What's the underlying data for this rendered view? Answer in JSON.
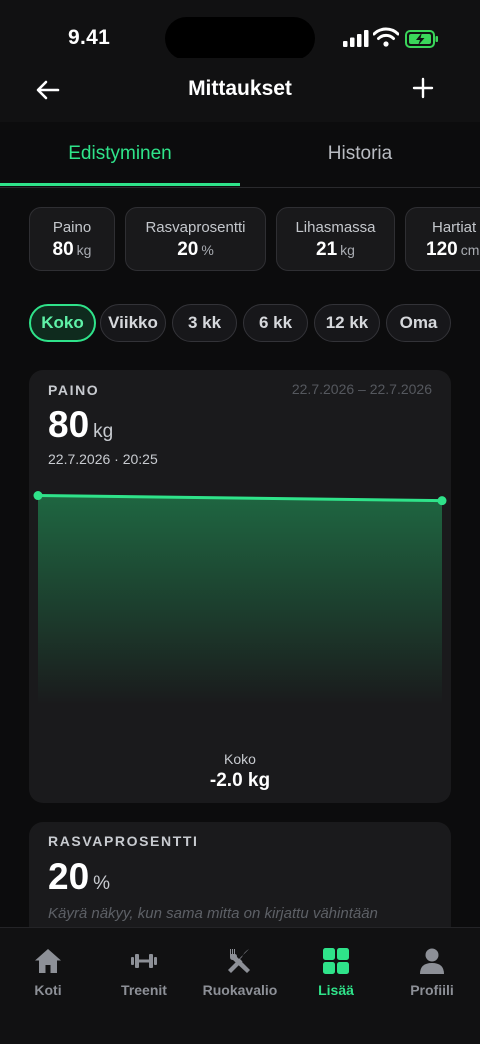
{
  "status_bar": {
    "time": "9.41"
  },
  "nav": {
    "title": "Mittaukset"
  },
  "tabs": [
    {
      "label": "Edistyminen",
      "active": true
    },
    {
      "label": "Historia",
      "active": false
    }
  ],
  "metrics": [
    {
      "label": "Paino",
      "value": "80",
      "unit": "kg"
    },
    {
      "label": "Rasvaprosentti",
      "value": "20",
      "unit": "%"
    },
    {
      "label": "Lihasmassa",
      "value": "21",
      "unit": "kg"
    },
    {
      "label": "Hartiat",
      "value": "120",
      "unit": "cm"
    }
  ],
  "ranges": [
    {
      "label": "Koko",
      "active": true
    },
    {
      "label": "Viikko",
      "active": false
    },
    {
      "label": "3 kk",
      "active": false
    },
    {
      "label": "6 kk",
      "active": false
    },
    {
      "label": "12 kk",
      "active": false
    },
    {
      "label": "Oma",
      "active": false
    }
  ],
  "weight_card": {
    "label": "PAINO",
    "range": "22.7.2026 – 22.7.2026",
    "value": "80",
    "unit": "kg",
    "date": "22.7.2026 · 20:25",
    "summary_label": "Koko",
    "summary_value": "-2.0 kg"
  },
  "chart_data": {
    "type": "area",
    "series": [
      {
        "values": [
          82,
          80
        ]
      }
    ],
    "line_color": "#2fe38a"
  },
  "fat_card": {
    "label": "RASVAPROSENTTI",
    "value": "20",
    "unit": "%",
    "hint": "Käyrä näkyy, kun sama mitta on kirjattu vähintään"
  },
  "tabbar": [
    {
      "label": "Koti",
      "icon": "home-icon",
      "active": false
    },
    {
      "label": "Treenit",
      "icon": "dumbbell-icon",
      "active": false
    },
    {
      "label": "Ruokavalio",
      "icon": "utensils-icon",
      "active": false
    },
    {
      "label": "Lisää",
      "icon": "grid-icon",
      "active": true
    },
    {
      "label": "Profiili",
      "icon": "person-icon",
      "active": false
    }
  ],
  "colors": {
    "accent": "#2fe38a",
    "background": "#0c0c0d",
    "card": "#1a1a1c"
  }
}
